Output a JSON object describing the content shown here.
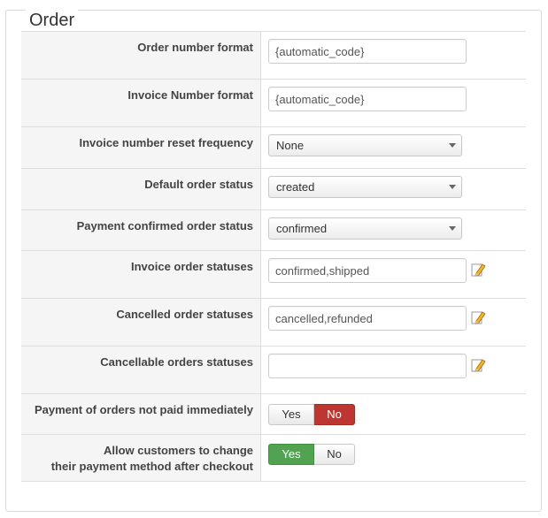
{
  "section": {
    "title": "Order"
  },
  "rows": [
    {
      "label": "Order number format",
      "value": "{automatic_code}"
    },
    {
      "label": "Invoice Number format",
      "value": "{automatic_code}"
    },
    {
      "label": "Invoice number reset frequency",
      "value": "None"
    },
    {
      "label": "Default order status",
      "value": "created"
    },
    {
      "label": "Payment confirmed order status",
      "value": "confirmed"
    },
    {
      "label": "Invoice order statuses",
      "value": "confirmed,shipped"
    },
    {
      "label": "Cancelled order statuses",
      "value": "cancelled,refunded"
    },
    {
      "label": "Cancellable orders statuses",
      "value": ""
    },
    {
      "label": "Payment of orders not paid immediately",
      "yes": "Yes",
      "no": "No",
      "selected": "No"
    },
    {
      "label_line1": "Allow customers to change",
      "label_line2": "their payment method after checkout",
      "yes": "Yes",
      "no": "No",
      "selected": "Yes"
    }
  ],
  "icons": {
    "edit": "edit-pencil-icon"
  },
  "colors": {
    "no_active": "#bd362f",
    "yes_active": "#51a351"
  }
}
